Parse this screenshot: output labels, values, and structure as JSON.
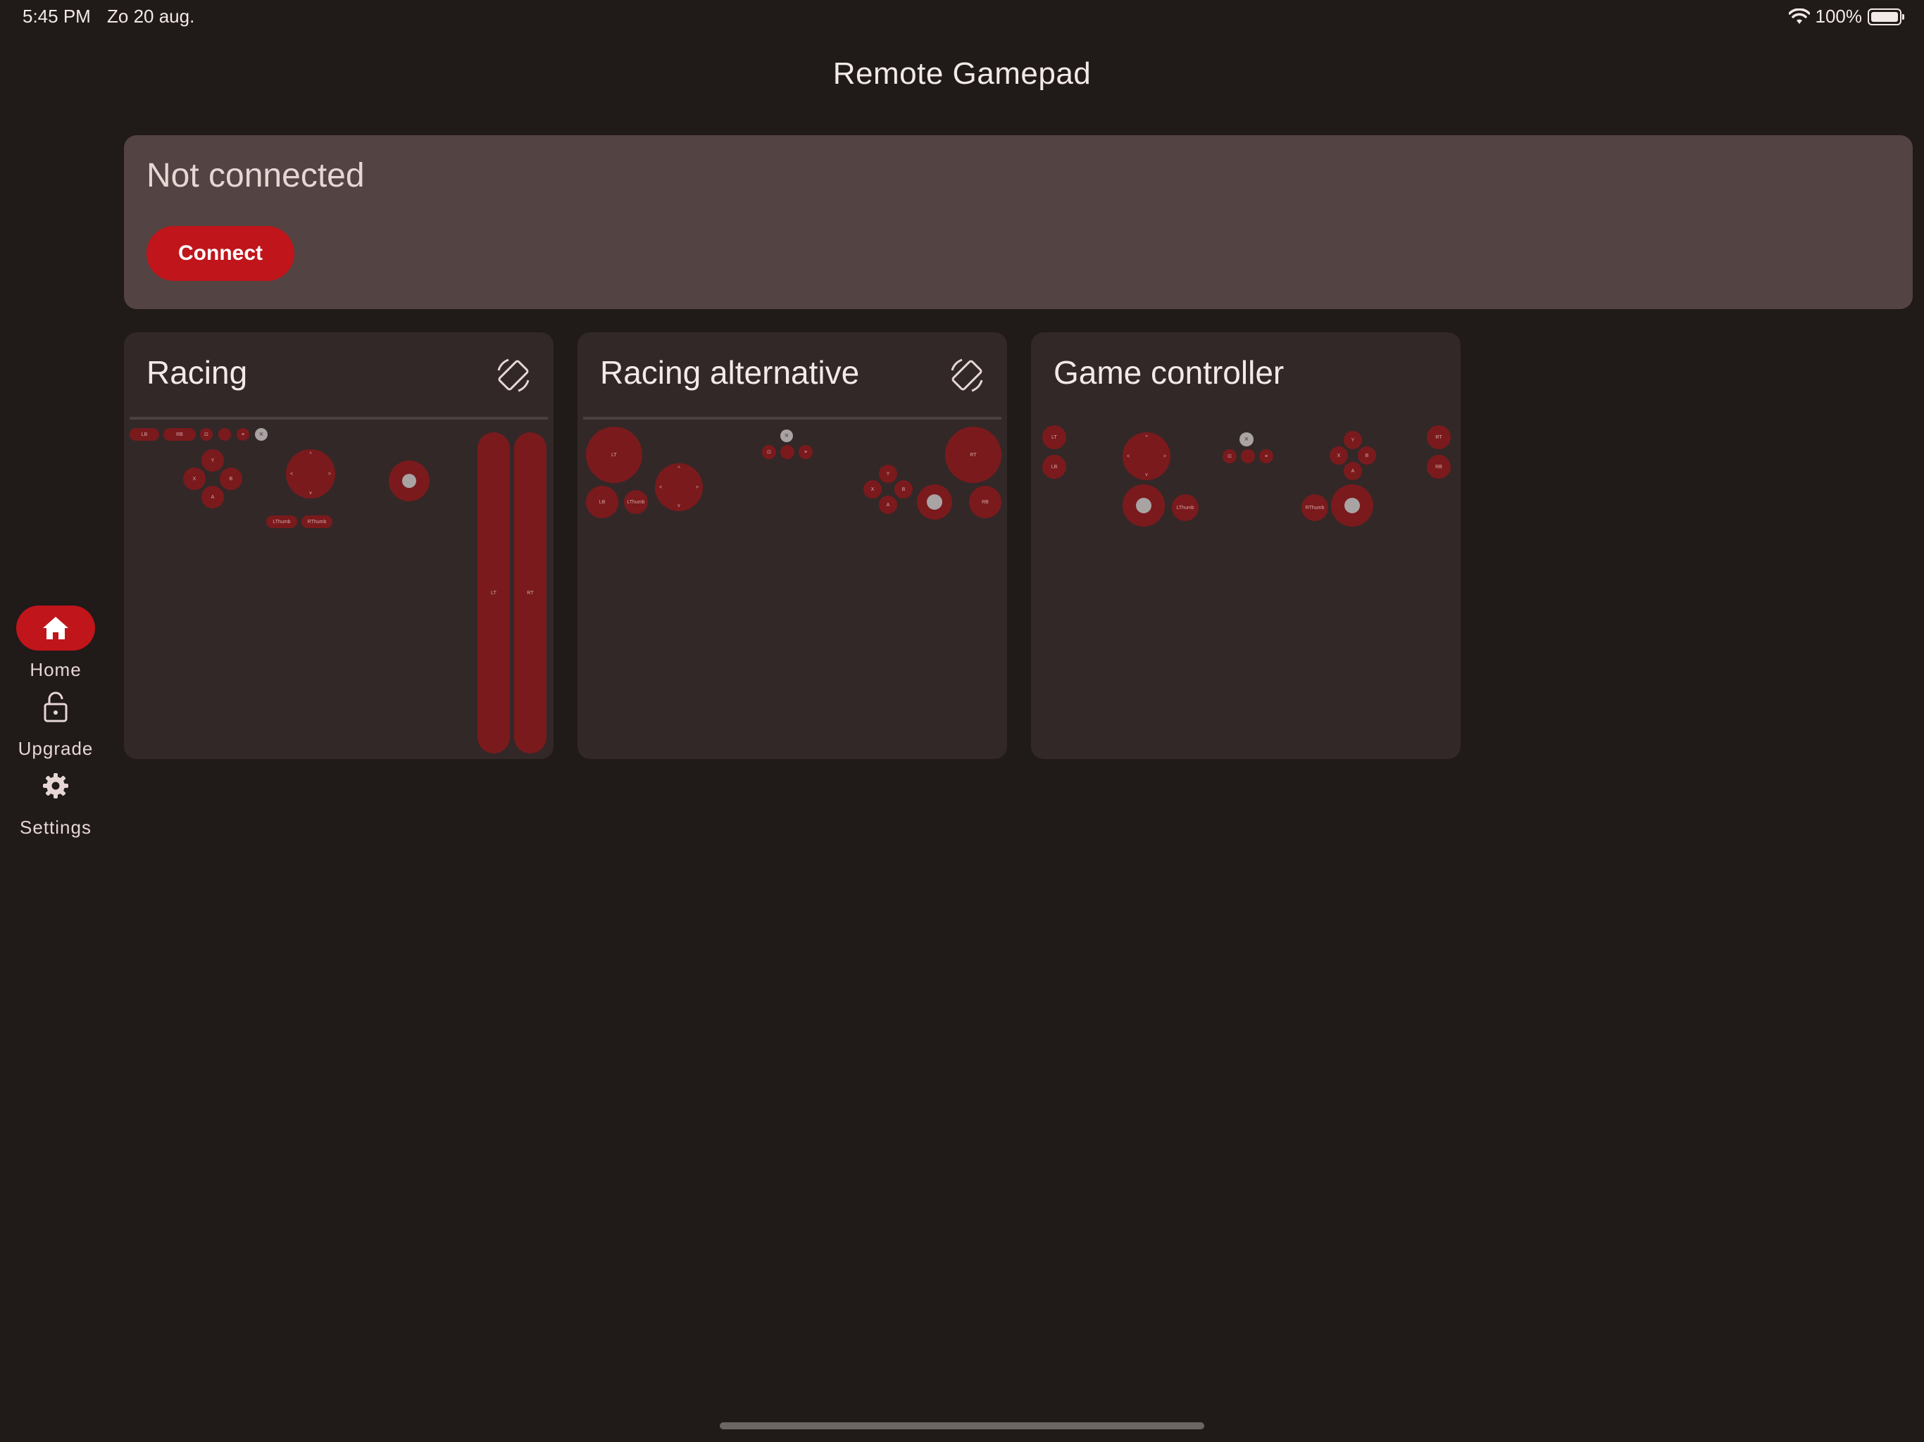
{
  "status_bar": {
    "time": "5:45 PM",
    "date": "Zo 20 aug.",
    "battery": "100%"
  },
  "app": {
    "title": "Remote Gamepad"
  },
  "connection": {
    "status": "Not connected",
    "button_label": "Connect"
  },
  "layouts": [
    {
      "name": "Racing",
      "rotatable": true,
      "labels": {
        "lb": "LB",
        "rb": "RB",
        "y": "Y",
        "x": "X",
        "b": "B",
        "a": "A",
        "up": "^",
        "left": "<",
        "right": ">",
        "down": "v",
        "lthumb": "LThumb",
        "rthumb": "RThumb",
        "lt": "LT",
        "rt": "RT"
      }
    },
    {
      "name": "Racing alternative",
      "rotatable": true,
      "labels": {
        "lt": "LT",
        "rt": "RT",
        "lb": "LB",
        "rb": "RB",
        "lthumb": "LThumb",
        "up": "^",
        "left": "<",
        "right": ">",
        "down": "v",
        "y": "Y",
        "x": "X",
        "b": "B",
        "a": "A"
      }
    },
    {
      "name": "Game controller",
      "rotatable": false,
      "labels": {
        "lt": "LT",
        "lb": "LB",
        "rt": "RT",
        "rb": "RB",
        "up": "^",
        "left": "<",
        "right": ">",
        "down": "v",
        "y": "Y",
        "x": "X",
        "b": "B",
        "a": "A",
        "lthumb": "LThumb",
        "rthumb": "RThumb"
      }
    }
  ],
  "nav": {
    "items": [
      {
        "label": "Home",
        "icon": "home-icon",
        "active": true
      },
      {
        "label": "Upgrade",
        "icon": "lock-icon",
        "active": false
      },
      {
        "label": "Settings",
        "icon": "gear-icon",
        "active": false
      }
    ]
  },
  "colors": {
    "accent": "#c0151b",
    "background": "#201a19",
    "card": "#322827",
    "connection_card": "#534342",
    "control": "#7a1a1d"
  }
}
